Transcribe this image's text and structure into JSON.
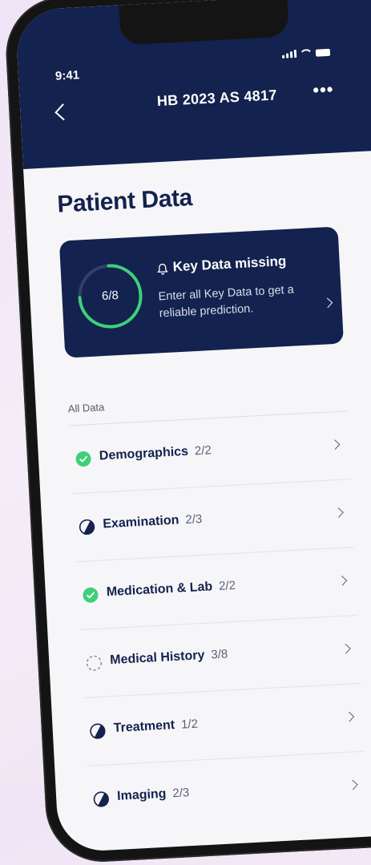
{
  "status_bar": {
    "time": "9:41"
  },
  "header": {
    "title": "HB 2023 AS 4817",
    "more": "•••"
  },
  "page": {
    "title": "Patient Data"
  },
  "key_card": {
    "progress_text": "6/8",
    "progress_fraction": 0.75,
    "title": "Key Data missing",
    "description": "Enter all Key Data to get a reliable prediction."
  },
  "section": {
    "label": "All Data"
  },
  "items": [
    {
      "label": "Demographics",
      "count": "2/2",
      "status": "complete"
    },
    {
      "label": "Examination",
      "count": "2/3",
      "status": "partial"
    },
    {
      "label": "Medication & Lab",
      "count": "2/2",
      "status": "complete"
    },
    {
      "label": "Medical History",
      "count": "3/8",
      "status": "empty"
    },
    {
      "label": "Treatment",
      "count": "1/2",
      "status": "partial"
    },
    {
      "label": "Imaging",
      "count": "2/3",
      "status": "partial"
    }
  ],
  "colors": {
    "navy": "#13224e",
    "green": "#3fcf7a",
    "background": "#f6f6f8"
  }
}
